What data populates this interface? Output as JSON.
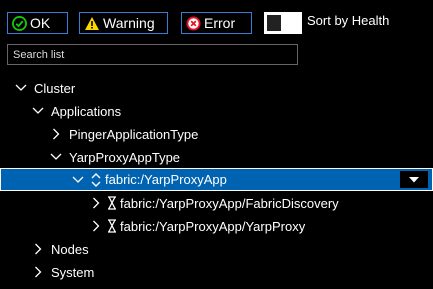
{
  "filters": {
    "ok_label": "OK",
    "warning_label": "Warning",
    "error_label": "Error",
    "sort_label": "Sort by Health"
  },
  "search": {
    "placeholder": "Search list"
  },
  "tree": {
    "cluster": "Cluster",
    "applications": "Applications",
    "pinger_type": "PingerApplicationType",
    "yarp_type": "YarpProxyAppType",
    "yarp_app": "fabric:/YarpProxyApp",
    "fabric_discovery": "fabric:/YarpProxyApp/FabricDiscovery",
    "yarp_proxy": "fabric:/YarpProxyApp/YarpProxy",
    "nodes": "Nodes",
    "system": "System"
  },
  "colors": {
    "selection": "#0063b1",
    "ok": "#16c60c",
    "warning": "#ffd700",
    "error": "#e81123",
    "accent_border": "#3a7bd5"
  }
}
